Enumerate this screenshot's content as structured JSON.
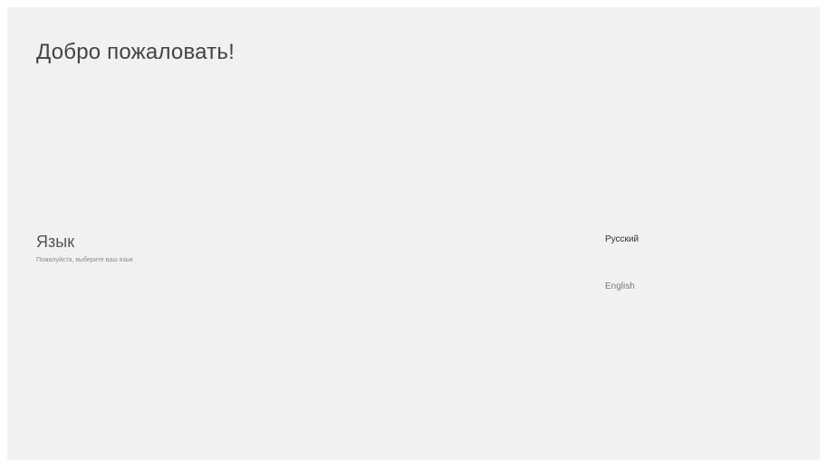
{
  "welcome": {
    "title": "Добро пожаловать!"
  },
  "language_section": {
    "title": "Язык",
    "subtitle": "Пожалуйста, выберите ваш язык"
  },
  "language_options": [
    {
      "label": "Русский",
      "selected": true
    },
    {
      "label": "English",
      "selected": false
    }
  ],
  "colors": {
    "background": "#f1f1f1",
    "text_primary": "#444444",
    "text_secondary": "#8a8a8a"
  }
}
